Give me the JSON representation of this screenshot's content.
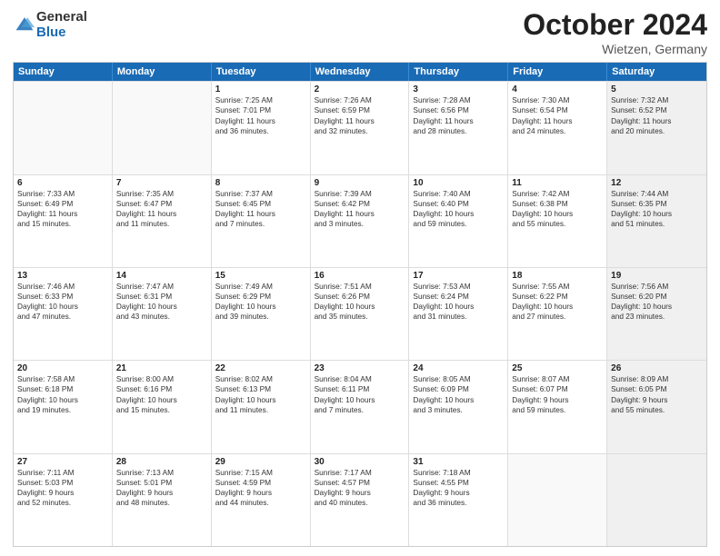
{
  "header": {
    "logo_line1": "General",
    "logo_line2": "Blue",
    "month": "October 2024",
    "location": "Wietzen, Germany"
  },
  "days": [
    "Sunday",
    "Monday",
    "Tuesday",
    "Wednesday",
    "Thursday",
    "Friday",
    "Saturday"
  ],
  "weeks": [
    [
      {
        "day": "",
        "sunrise": "",
        "sunset": "",
        "daylight": "",
        "shaded": false
      },
      {
        "day": "",
        "sunrise": "",
        "sunset": "",
        "daylight": "",
        "shaded": false
      },
      {
        "day": "1",
        "sunrise": "Sunrise: 7:25 AM",
        "sunset": "Sunset: 7:01 PM",
        "daylight": "Daylight: 11 hours and 36 minutes.",
        "shaded": false
      },
      {
        "day": "2",
        "sunrise": "Sunrise: 7:26 AM",
        "sunset": "Sunset: 6:59 PM",
        "daylight": "Daylight: 11 hours and 32 minutes.",
        "shaded": false
      },
      {
        "day": "3",
        "sunrise": "Sunrise: 7:28 AM",
        "sunset": "Sunset: 6:56 PM",
        "daylight": "Daylight: 11 hours and 28 minutes.",
        "shaded": false
      },
      {
        "day": "4",
        "sunrise": "Sunrise: 7:30 AM",
        "sunset": "Sunset: 6:54 PM",
        "daylight": "Daylight: 11 hours and 24 minutes.",
        "shaded": false
      },
      {
        "day": "5",
        "sunrise": "Sunrise: 7:32 AM",
        "sunset": "Sunset: 6:52 PM",
        "daylight": "Daylight: 11 hours and 20 minutes.",
        "shaded": true
      }
    ],
    [
      {
        "day": "6",
        "sunrise": "Sunrise: 7:33 AM",
        "sunset": "Sunset: 6:49 PM",
        "daylight": "Daylight: 11 hours and 15 minutes.",
        "shaded": false
      },
      {
        "day": "7",
        "sunrise": "Sunrise: 7:35 AM",
        "sunset": "Sunset: 6:47 PM",
        "daylight": "Daylight: 11 hours and 11 minutes.",
        "shaded": false
      },
      {
        "day": "8",
        "sunrise": "Sunrise: 7:37 AM",
        "sunset": "Sunset: 6:45 PM",
        "daylight": "Daylight: 11 hours and 7 minutes.",
        "shaded": false
      },
      {
        "day": "9",
        "sunrise": "Sunrise: 7:39 AM",
        "sunset": "Sunset: 6:42 PM",
        "daylight": "Daylight: 11 hours and 3 minutes.",
        "shaded": false
      },
      {
        "day": "10",
        "sunrise": "Sunrise: 7:40 AM",
        "sunset": "Sunset: 6:40 PM",
        "daylight": "Daylight: 10 hours and 59 minutes.",
        "shaded": false
      },
      {
        "day": "11",
        "sunrise": "Sunrise: 7:42 AM",
        "sunset": "Sunset: 6:38 PM",
        "daylight": "Daylight: 10 hours and 55 minutes.",
        "shaded": false
      },
      {
        "day": "12",
        "sunrise": "Sunrise: 7:44 AM",
        "sunset": "Sunset: 6:35 PM",
        "daylight": "Daylight: 10 hours and 51 minutes.",
        "shaded": true
      }
    ],
    [
      {
        "day": "13",
        "sunrise": "Sunrise: 7:46 AM",
        "sunset": "Sunset: 6:33 PM",
        "daylight": "Daylight: 10 hours and 47 minutes.",
        "shaded": false
      },
      {
        "day": "14",
        "sunrise": "Sunrise: 7:47 AM",
        "sunset": "Sunset: 6:31 PM",
        "daylight": "Daylight: 10 hours and 43 minutes.",
        "shaded": false
      },
      {
        "day": "15",
        "sunrise": "Sunrise: 7:49 AM",
        "sunset": "Sunset: 6:29 PM",
        "daylight": "Daylight: 10 hours and 39 minutes.",
        "shaded": false
      },
      {
        "day": "16",
        "sunrise": "Sunrise: 7:51 AM",
        "sunset": "Sunset: 6:26 PM",
        "daylight": "Daylight: 10 hours and 35 minutes.",
        "shaded": false
      },
      {
        "day": "17",
        "sunrise": "Sunrise: 7:53 AM",
        "sunset": "Sunset: 6:24 PM",
        "daylight": "Daylight: 10 hours and 31 minutes.",
        "shaded": false
      },
      {
        "day": "18",
        "sunrise": "Sunrise: 7:55 AM",
        "sunset": "Sunset: 6:22 PM",
        "daylight": "Daylight: 10 hours and 27 minutes.",
        "shaded": false
      },
      {
        "day": "19",
        "sunrise": "Sunrise: 7:56 AM",
        "sunset": "Sunset: 6:20 PM",
        "daylight": "Daylight: 10 hours and 23 minutes.",
        "shaded": true
      }
    ],
    [
      {
        "day": "20",
        "sunrise": "Sunrise: 7:58 AM",
        "sunset": "Sunset: 6:18 PM",
        "daylight": "Daylight: 10 hours and 19 minutes.",
        "shaded": false
      },
      {
        "day": "21",
        "sunrise": "Sunrise: 8:00 AM",
        "sunset": "Sunset: 6:16 PM",
        "daylight": "Daylight: 10 hours and 15 minutes.",
        "shaded": false
      },
      {
        "day": "22",
        "sunrise": "Sunrise: 8:02 AM",
        "sunset": "Sunset: 6:13 PM",
        "daylight": "Daylight: 10 hours and 11 minutes.",
        "shaded": false
      },
      {
        "day": "23",
        "sunrise": "Sunrise: 8:04 AM",
        "sunset": "Sunset: 6:11 PM",
        "daylight": "Daylight: 10 hours and 7 minutes.",
        "shaded": false
      },
      {
        "day": "24",
        "sunrise": "Sunrise: 8:05 AM",
        "sunset": "Sunset: 6:09 PM",
        "daylight": "Daylight: 10 hours and 3 minutes.",
        "shaded": false
      },
      {
        "day": "25",
        "sunrise": "Sunrise: 8:07 AM",
        "sunset": "Sunset: 6:07 PM",
        "daylight": "Daylight: 9 hours and 59 minutes.",
        "shaded": false
      },
      {
        "day": "26",
        "sunrise": "Sunrise: 8:09 AM",
        "sunset": "Sunset: 6:05 PM",
        "daylight": "Daylight: 9 hours and 55 minutes.",
        "shaded": true
      }
    ],
    [
      {
        "day": "27",
        "sunrise": "Sunrise: 7:11 AM",
        "sunset": "Sunset: 5:03 PM",
        "daylight": "Daylight: 9 hours and 52 minutes.",
        "shaded": false
      },
      {
        "day": "28",
        "sunrise": "Sunrise: 7:13 AM",
        "sunset": "Sunset: 5:01 PM",
        "daylight": "Daylight: 9 hours and 48 minutes.",
        "shaded": false
      },
      {
        "day": "29",
        "sunrise": "Sunrise: 7:15 AM",
        "sunset": "Sunset: 4:59 PM",
        "daylight": "Daylight: 9 hours and 44 minutes.",
        "shaded": false
      },
      {
        "day": "30",
        "sunrise": "Sunrise: 7:17 AM",
        "sunset": "Sunset: 4:57 PM",
        "daylight": "Daylight: 9 hours and 40 minutes.",
        "shaded": false
      },
      {
        "day": "31",
        "sunrise": "Sunrise: 7:18 AM",
        "sunset": "Sunset: 4:55 PM",
        "daylight": "Daylight: 9 hours and 36 minutes.",
        "shaded": false
      },
      {
        "day": "",
        "sunrise": "",
        "sunset": "",
        "daylight": "",
        "shaded": false
      },
      {
        "day": "",
        "sunrise": "",
        "sunset": "",
        "daylight": "",
        "shaded": true
      }
    ]
  ]
}
